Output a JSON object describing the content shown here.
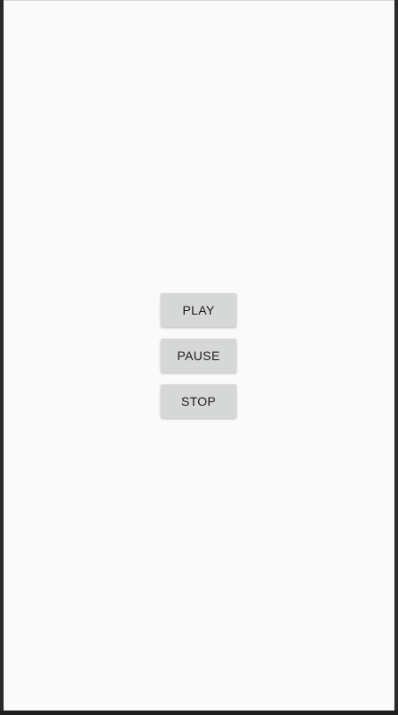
{
  "controls": {
    "play_label": "PLAY",
    "pause_label": "PAUSE",
    "stop_label": "STOP"
  },
  "colors": {
    "background": "#fafafa",
    "button": "#d6d7d7",
    "button_text": "#1c1c1c"
  }
}
